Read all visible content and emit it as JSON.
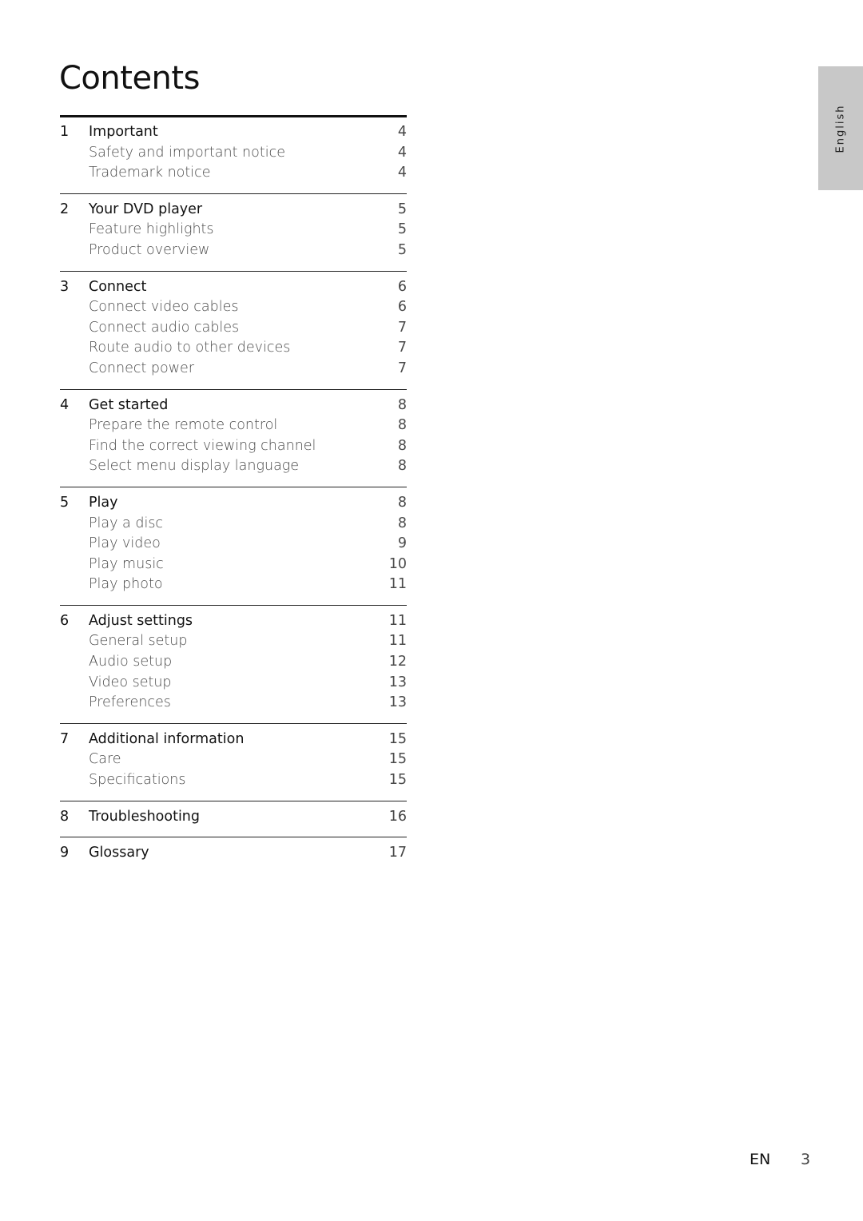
{
  "page": {
    "title": "Contents",
    "language_tab": "English",
    "footer": {
      "lang": "EN",
      "page_number": "3"
    }
  },
  "toc": [
    {
      "number": "1",
      "title": "Important",
      "page": "4",
      "items": [
        {
          "title": "Safety and important notice",
          "page": "4"
        },
        {
          "title": "Trademark notice",
          "page": "4"
        }
      ]
    },
    {
      "number": "2",
      "title": "Your DVD player",
      "page": "5",
      "items": [
        {
          "title": "Feature highlights",
          "page": "5"
        },
        {
          "title": "Product overview",
          "page": "5"
        }
      ]
    },
    {
      "number": "3",
      "title": "Connect",
      "page": "6",
      "items": [
        {
          "title": "Connect video cables",
          "page": "6"
        },
        {
          "title": "Connect audio cables",
          "page": "7"
        },
        {
          "title": "Route audio to other devices",
          "page": "7"
        },
        {
          "title": "Connect power",
          "page": "7"
        }
      ]
    },
    {
      "number": "4",
      "title": "Get started",
      "page": "8",
      "items": [
        {
          "title": "Prepare the remote control",
          "page": "8"
        },
        {
          "title": "Find the correct viewing channel",
          "page": "8"
        },
        {
          "title": "Select menu display language",
          "page": "8"
        }
      ]
    },
    {
      "number": "5",
      "title": "Play",
      "page": "8",
      "items": [
        {
          "title": "Play a disc",
          "page": "8"
        },
        {
          "title": "Play video",
          "page": "9"
        },
        {
          "title": "Play music",
          "page": "10"
        },
        {
          "title": "Play photo",
          "page": "11"
        }
      ]
    },
    {
      "number": "6",
      "title": "Adjust settings",
      "page": "11",
      "items": [
        {
          "title": "General setup",
          "page": "11"
        },
        {
          "title": "Audio setup",
          "page": "12"
        },
        {
          "title": "Video setup",
          "page": "13"
        },
        {
          "title": "Preferences",
          "page": "13"
        }
      ]
    },
    {
      "number": "7",
      "title": "Additional information",
      "page": "15",
      "items": [
        {
          "title": "Care",
          "page": "15"
        },
        {
          "title": "Specifications",
          "page": "15"
        }
      ]
    },
    {
      "number": "8",
      "title": "Troubleshooting",
      "page": "16",
      "items": []
    },
    {
      "number": "9",
      "title": "Glossary",
      "page": "17",
      "items": []
    }
  ]
}
